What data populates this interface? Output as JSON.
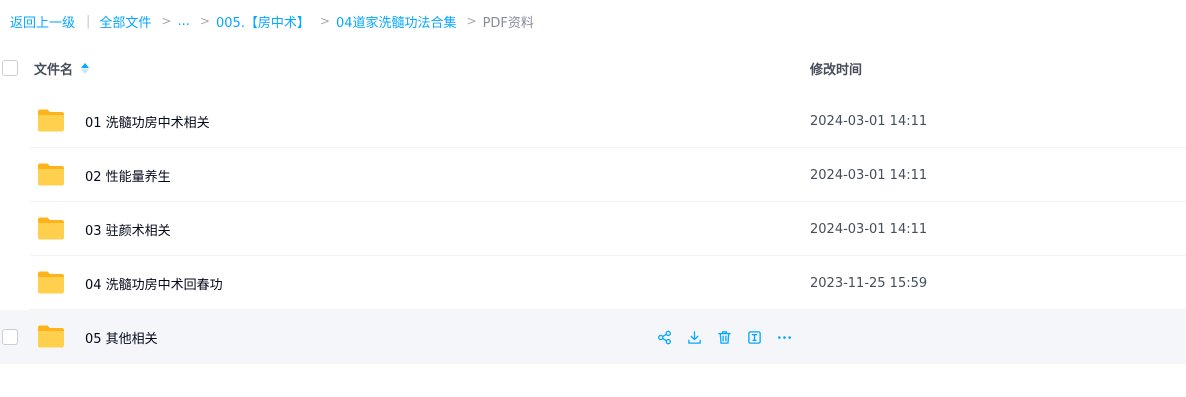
{
  "breadcrumb": {
    "back": "返回上一级",
    "all_files": "全部文件",
    "ellipsis": "...",
    "level1": "005.【房中术】",
    "level2": "04道家洗髓功法合集",
    "current": "PDF资料"
  },
  "header": {
    "name_label": "文件名",
    "time_label": "修改时间"
  },
  "colors": {
    "accent": "#06a7ff",
    "folder": "#ffc933"
  },
  "rows": [
    {
      "name": "01 洗髓功房中术相关",
      "time": "2024-03-01 14:11",
      "icon": "folder-icon"
    },
    {
      "name": "02 性能量养生",
      "time": "2024-03-01 14:11",
      "icon": "folder-icon"
    },
    {
      "name": "03 驻颜术相关",
      "time": "2024-03-01 14:11",
      "icon": "folder-icon"
    },
    {
      "name": "04 洗髓功房中术回春功",
      "time": "2023-11-25 15:59",
      "icon": "folder-icon"
    },
    {
      "name": "05 其他相关",
      "time": "",
      "icon": "folder-icon"
    }
  ],
  "row_actions": [
    "share-icon",
    "download-icon",
    "delete-icon",
    "rename-icon",
    "more-icon"
  ]
}
